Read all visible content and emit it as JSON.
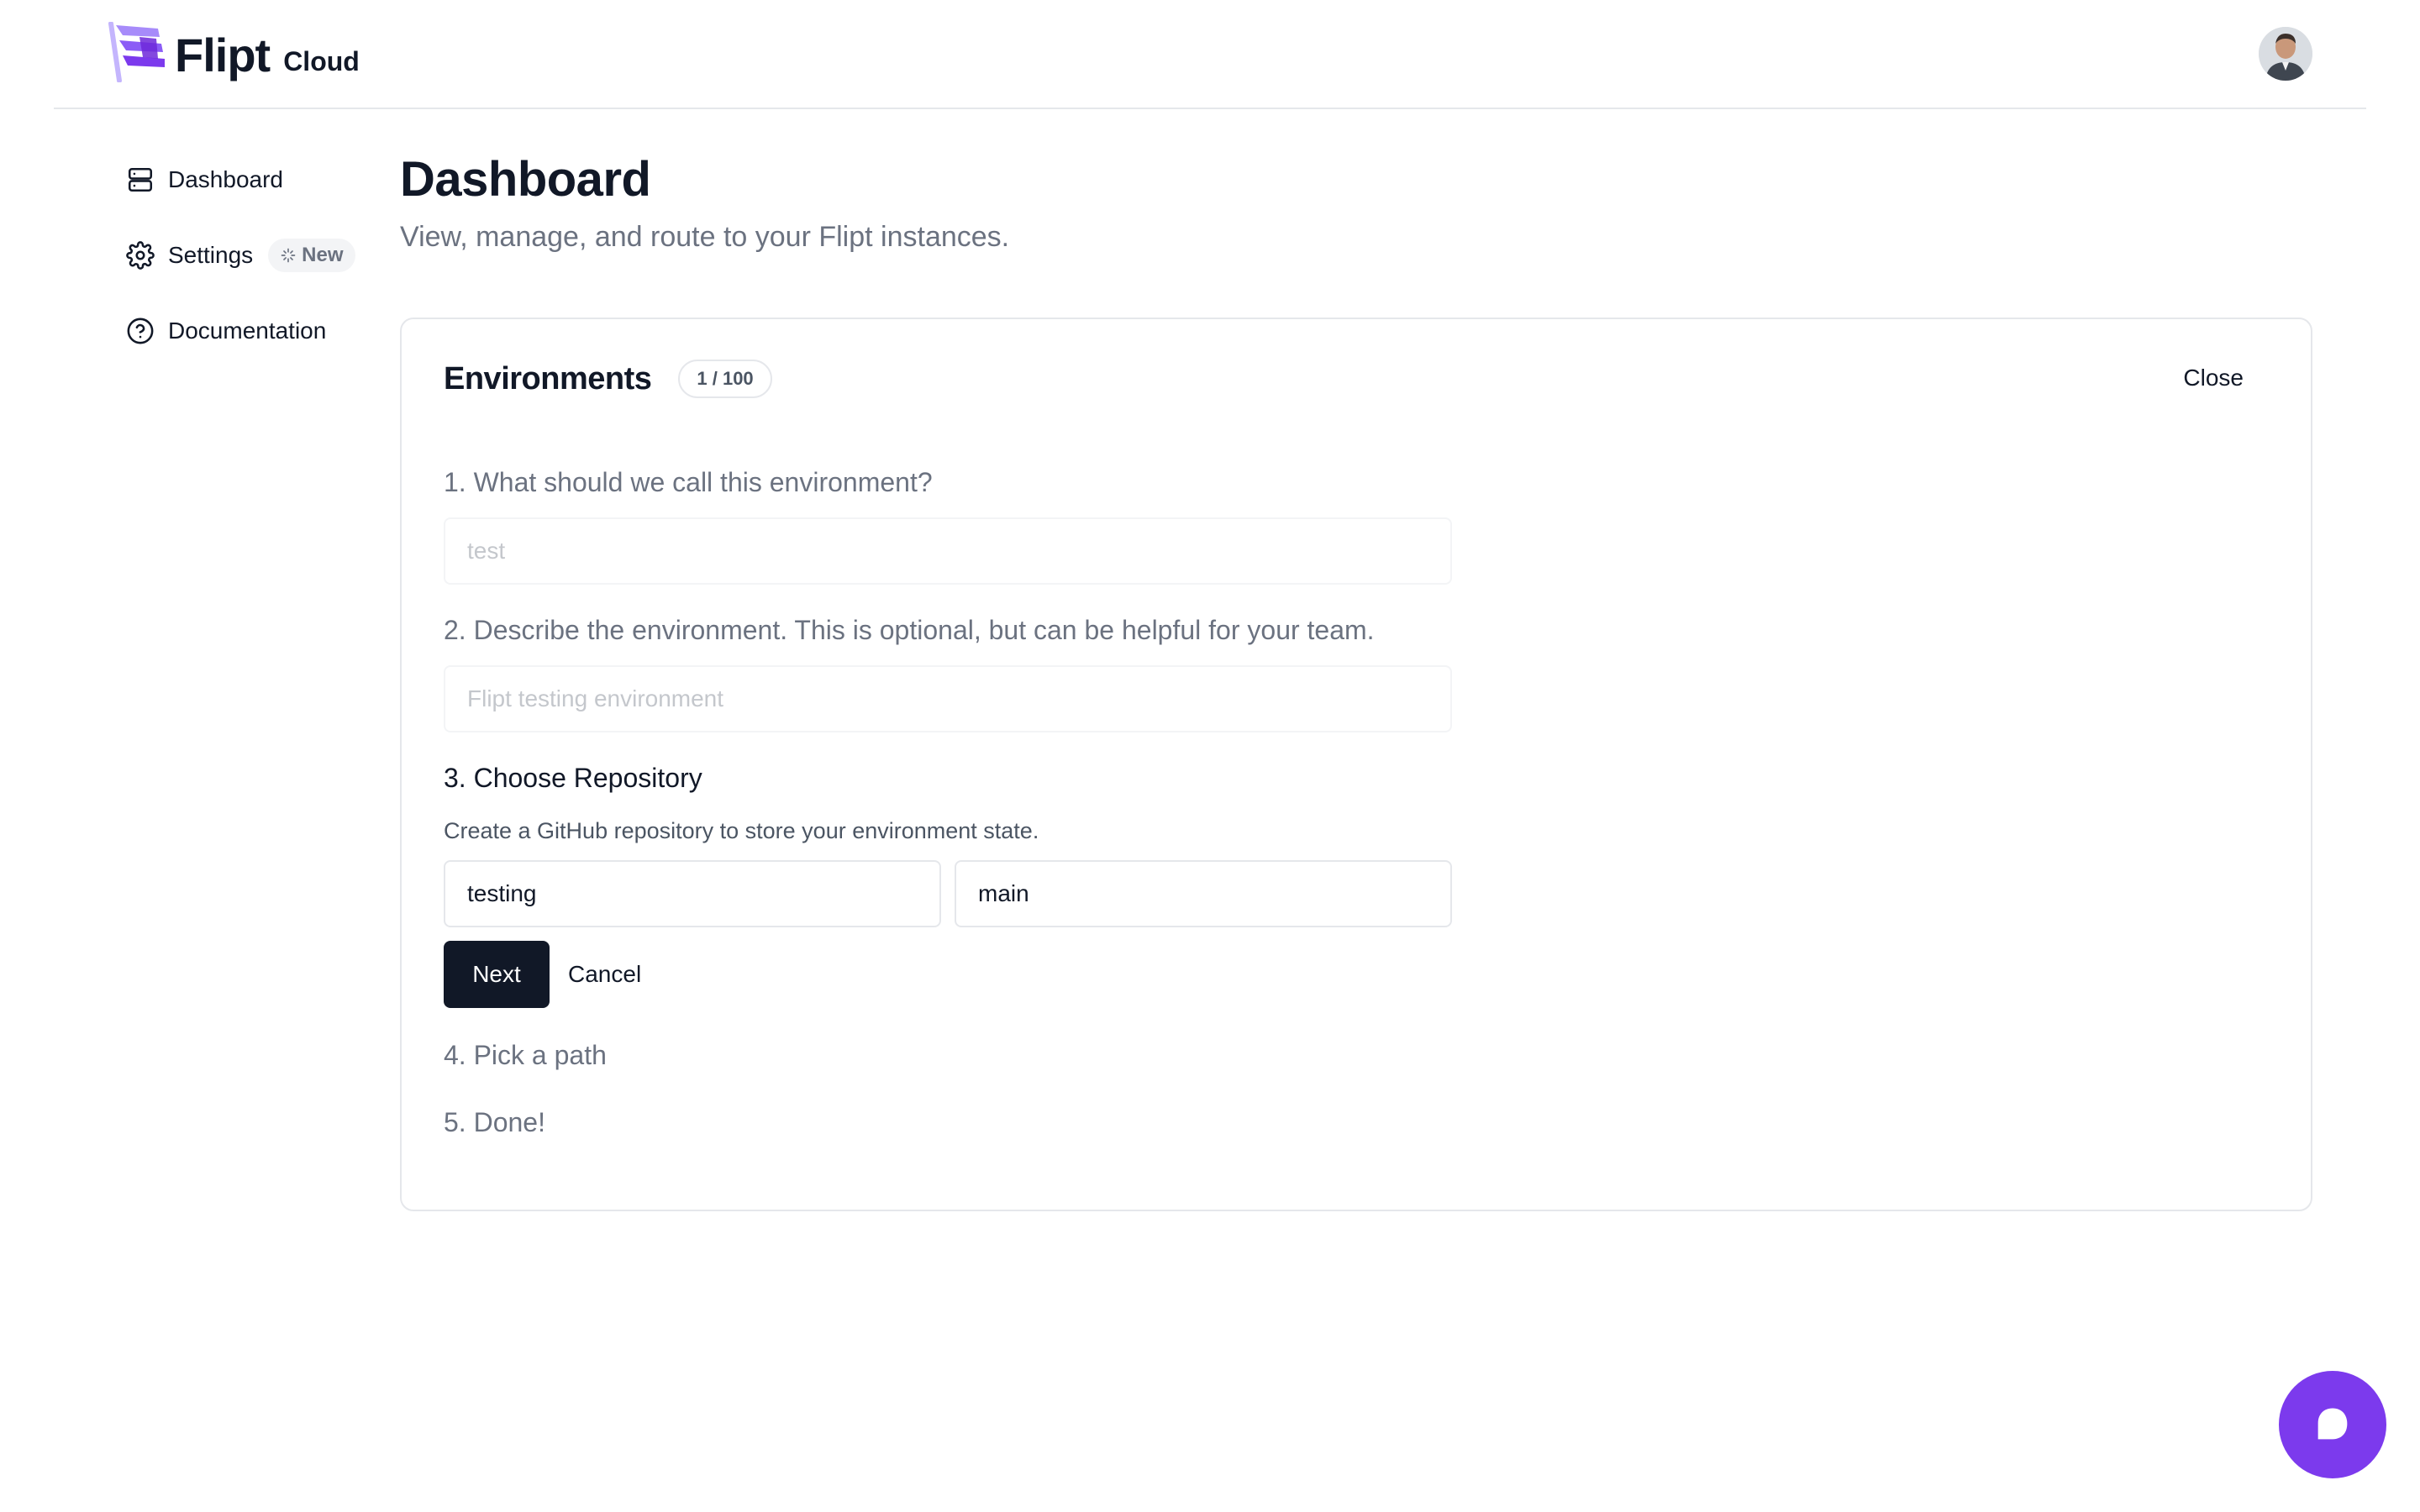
{
  "brand": {
    "name": "Flipt",
    "product": "Cloud",
    "accent": "#7c3aed"
  },
  "header": {
    "avatar_icon": "user-avatar"
  },
  "sidebar": {
    "items": [
      {
        "label": "Dashboard",
        "icon": "server-icon"
      },
      {
        "label": "Settings",
        "icon": "gear-icon",
        "badge": "New"
      },
      {
        "label": "Documentation",
        "icon": "help-circle-icon"
      }
    ]
  },
  "main": {
    "title": "Dashboard",
    "subtitle": "View, manage, and route to your Flipt instances."
  },
  "card": {
    "title": "Environments",
    "count": "1 / 100",
    "close_label": "Close",
    "steps": {
      "s1": {
        "label": "1. What should we call this environment?",
        "value": "test"
      },
      "s2": {
        "label": "2. Describe the environment. This is optional, but can be helpful for your team.",
        "value": "Flipt testing environment"
      },
      "s3": {
        "label": "3. Choose Repository",
        "help": "Create a GitHub repository to store your environment state.",
        "repo_value": "testing",
        "branch_value": "main"
      },
      "s4": {
        "label": "4. Pick a path"
      },
      "s5": {
        "label": "5. Done!"
      }
    },
    "next_label": "Next",
    "cancel_label": "Cancel"
  },
  "chat": {
    "icon": "chat-icon"
  }
}
